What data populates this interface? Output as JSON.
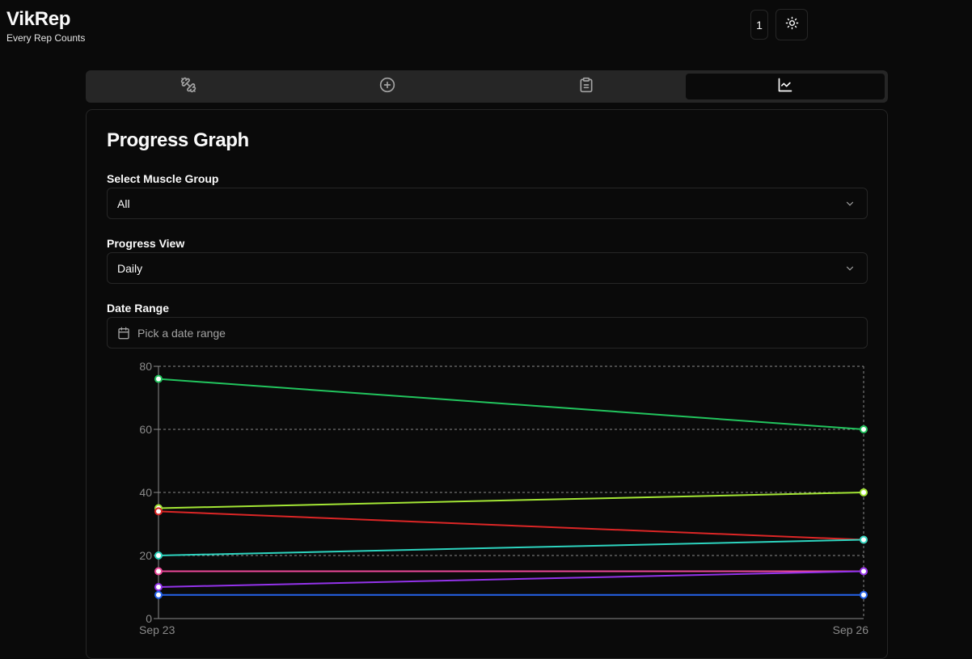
{
  "app": {
    "title": "VikRep",
    "tagline": "Every Rep Counts"
  },
  "header": {
    "notification_count": "1",
    "theme_icon": "sun-icon"
  },
  "tabs": [
    {
      "icon": "dumbbell-icon",
      "active": false
    },
    {
      "icon": "plus-circle-icon",
      "active": false
    },
    {
      "icon": "clipboard-icon",
      "active": false
    },
    {
      "icon": "line-chart-icon",
      "active": true
    }
  ],
  "card": {
    "title": "Progress Graph",
    "muscle_group": {
      "label": "Select Muscle Group",
      "value": "All"
    },
    "progress_view": {
      "label": "Progress View",
      "value": "Daily"
    },
    "date_range": {
      "label": "Date Range",
      "placeholder": "Pick a date range"
    }
  },
  "chart_data": {
    "type": "line",
    "x": [
      "Sep 23",
      "Sep 26"
    ],
    "ylim": [
      0,
      80
    ],
    "yticks": [
      0,
      20,
      40,
      60,
      80
    ],
    "grid": true,
    "series": [
      {
        "color": "#22c55e",
        "values": [
          76,
          60
        ]
      },
      {
        "color": "#a3e635",
        "values": [
          35,
          40
        ]
      },
      {
        "color": "#dc2626",
        "values": [
          34,
          25
        ]
      },
      {
        "color": "#2dd4bf",
        "values": [
          20,
          25
        ]
      },
      {
        "color": "#ec4899",
        "values": [
          15,
          15
        ]
      },
      {
        "color": "#9333ea",
        "values": [
          10,
          15
        ]
      },
      {
        "color": "#2563eb",
        "values": [
          7.5,
          7.5
        ]
      }
    ]
  }
}
